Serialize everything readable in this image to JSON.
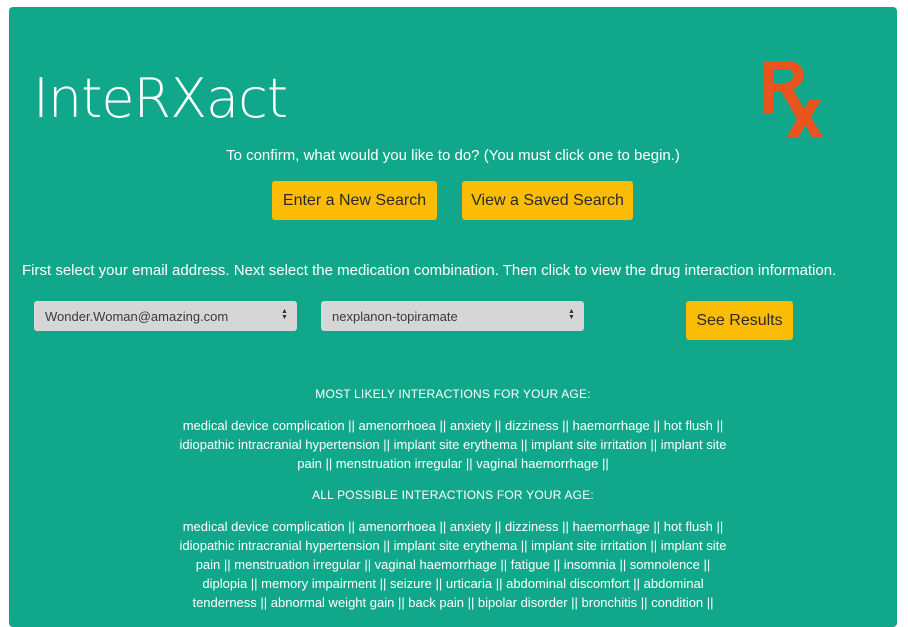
{
  "app": {
    "title": "InteRXact",
    "logo_icon": "prescription-rx-icon",
    "logo_color": "#e9541f"
  },
  "colors": {
    "panel_bg": "#10a78a",
    "button_bg": "#fbbc05",
    "select_bg": "#d6d6d6"
  },
  "prompt": "To confirm, what would you like to do? (You must click one to begin.)",
  "actions": {
    "new_search": "Enter a New Search",
    "saved_search": "View a Saved Search"
  },
  "instructions": "First select your email address. Next select the medication combination. Then click to view the drug interaction information.",
  "form": {
    "email_value": "Wonder.Woman@amazing.com",
    "medication_value": "nexplanon-topiramate",
    "results_label": "See Results"
  },
  "results": {
    "likely_heading": "MOST LIKELY INTERACTIONS FOR YOUR AGE:",
    "likely_text": "medical device complication || amenorrhoea || anxiety || dizziness || haemorrhage || hot flush || idiopathic intracranial hypertension || implant site erythema || implant site irritation || implant site pain || menstruation irregular || vaginal haemorrhage ||",
    "all_heading": "ALL POSSIBLE INTERACTIONS FOR YOUR AGE:",
    "all_text": "medical device complication || amenorrhoea || anxiety || dizziness || haemorrhage || hot flush || idiopathic intracranial hypertension || implant site erythema || implant site irritation || implant site pain || menstruation irregular || vaginal haemorrhage || fatigue || insomnia || somnolence || diplopia || memory impairment || seizure || urticaria || abdominal discomfort || abdominal tenderness || abnormal weight gain || back pain || bipolar disorder || bronchitis || condition ||"
  }
}
